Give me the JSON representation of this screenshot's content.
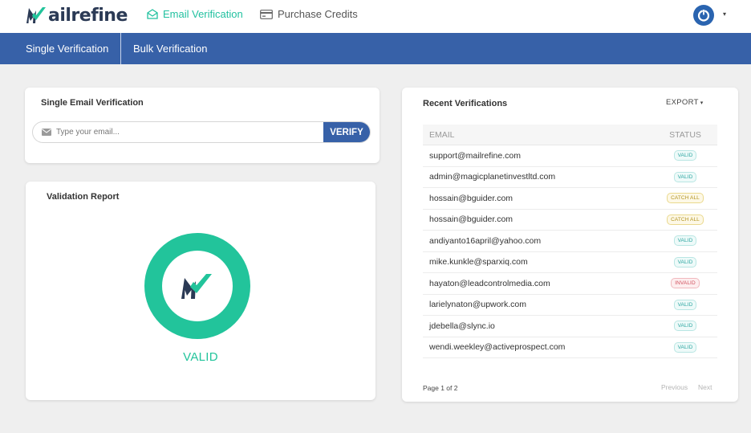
{
  "header": {
    "logo_text": "ailrefine",
    "nav": [
      {
        "label": "Email Verification",
        "icon": "envelope-open-icon",
        "active": true
      },
      {
        "label": "Purchase Credits",
        "icon": "credit-card-icon",
        "active": false
      }
    ],
    "user_icon": "power-icon",
    "caret": "▾"
  },
  "subnav": {
    "items": [
      {
        "label": "Single Verification"
      },
      {
        "label": "Bulk Verification"
      }
    ]
  },
  "single_card": {
    "title": "Single Email Verification",
    "input_placeholder": "Type your email...",
    "input_value": "",
    "verify_label": "VERIFY"
  },
  "report_card": {
    "title": "Validation Report",
    "result": "VALID"
  },
  "recent_card": {
    "title": "Recent Verifications",
    "export_label": "EXPORT",
    "columns": [
      "EMAIL",
      "STATUS"
    ],
    "rows": [
      {
        "email": "support@mailrefine.com",
        "status": "VALID",
        "kind": "valid"
      },
      {
        "email": "admin@magicplanetinvestltd.com",
        "status": "VALID",
        "kind": "valid"
      },
      {
        "email": "hossain@bguider.com",
        "status": "CATCH ALL",
        "kind": "catch"
      },
      {
        "email": "hossain@bguider.com",
        "status": "CATCH ALL",
        "kind": "catch"
      },
      {
        "email": "andiyanto16april@yahoo.com",
        "status": "VALID",
        "kind": "valid"
      },
      {
        "email": "mike.kunkle@sparxiq.com",
        "status": "VALID",
        "kind": "valid"
      },
      {
        "email": "hayaton@leadcontrolmedia.com",
        "status": "INVALID",
        "kind": "invalid"
      },
      {
        "email": "larielynaton@upwork.com",
        "status": "VALID",
        "kind": "valid"
      },
      {
        "email": "jdebella@slync.io",
        "status": "VALID",
        "kind": "valid"
      },
      {
        "email": "wendi.weekley@activeprospect.com",
        "status": "VALID",
        "kind": "valid"
      }
    ],
    "page_info": "Page 1 of 2",
    "prev_label": "Previous",
    "next_label": "Next"
  },
  "colors": {
    "brand_blue": "#3761a8",
    "accent_green": "#22c49b",
    "logo_navy": "#2b3a55"
  }
}
